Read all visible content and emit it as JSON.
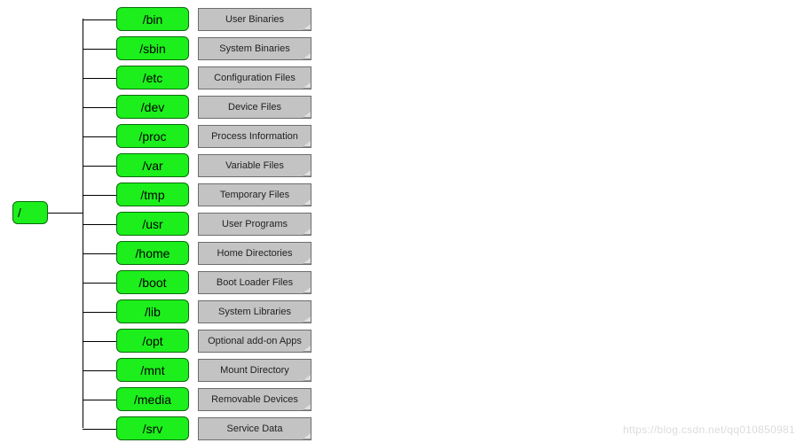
{
  "root": {
    "label": "/"
  },
  "entries": [
    {
      "dir": "/bin",
      "desc": "User Binaries"
    },
    {
      "dir": "/sbin",
      "desc": "System Binaries"
    },
    {
      "dir": "/etc",
      "desc": "Configuration Files"
    },
    {
      "dir": "/dev",
      "desc": "Device Files"
    },
    {
      "dir": "/proc",
      "desc": "Process Information"
    },
    {
      "dir": "/var",
      "desc": "Variable Files"
    },
    {
      "dir": "/tmp",
      "desc": "Temporary Files"
    },
    {
      "dir": "/usr",
      "desc": "User Programs"
    },
    {
      "dir": "/home",
      "desc": "Home Directories"
    },
    {
      "dir": "/boot",
      "desc": "Boot Loader Files"
    },
    {
      "dir": "/lib",
      "desc": "System Libraries"
    },
    {
      "dir": "/opt",
      "desc": "Optional add-on Apps"
    },
    {
      "dir": "/mnt",
      "desc": "Mount Directory"
    },
    {
      "dir": "/media",
      "desc": "Removable Devices"
    },
    {
      "dir": "/srv",
      "desc": "Service Data"
    }
  ],
  "watermark": "https://blog.csdn.net/qq010850981"
}
